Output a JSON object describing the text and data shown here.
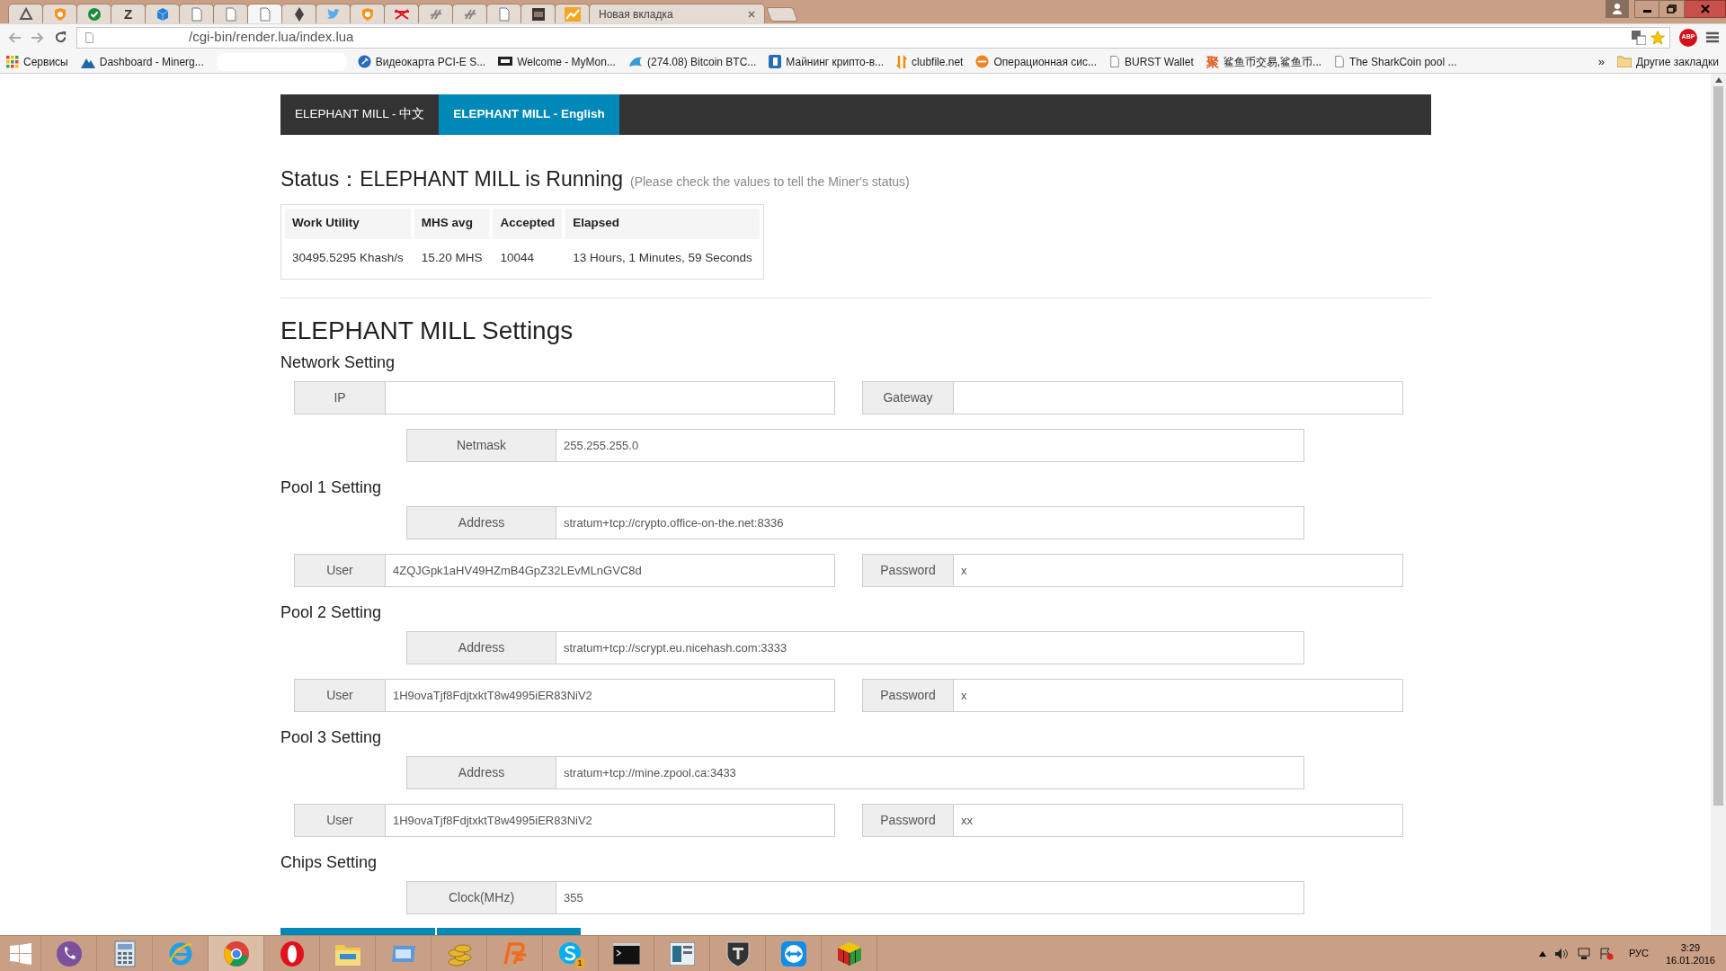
{
  "browser": {
    "tabs": [
      {
        "kind": "triangle",
        "selected": false
      },
      {
        "kind": "coin",
        "selected": false
      },
      {
        "kind": "check",
        "selected": false
      },
      {
        "kind": "letter",
        "glyph": "Z",
        "selected": false
      },
      {
        "kind": "cube",
        "selected": false
      },
      {
        "kind": "doc",
        "selected": false
      },
      {
        "kind": "doc",
        "selected": false
      },
      {
        "kind": "doc",
        "selected": true
      },
      {
        "kind": "diamond",
        "selected": false
      },
      {
        "kind": "bird",
        "selected": false
      },
      {
        "kind": "coin",
        "selected": false
      },
      {
        "kind": "cross",
        "selected": false
      },
      {
        "kind": "chain",
        "selected": false
      },
      {
        "kind": "chain",
        "selected": false
      },
      {
        "kind": "doc",
        "selected": false
      },
      {
        "kind": "box",
        "selected": false
      },
      {
        "kind": "chart",
        "selected": false
      },
      {
        "kind": "text",
        "label": "Новая вкладка",
        "selected": false
      }
    ],
    "url": "/cgi-bin/render.lua/index.lua",
    "adblock": "ABP",
    "bookmarks": [
      {
        "kind": "apps",
        "label": "Сервисы"
      },
      {
        "kind": "mountain",
        "label": "Dashboard - Minerg..."
      },
      {
        "kind": "redacted"
      },
      {
        "kind": "globe",
        "label": "Видеокарта PCI-E S..."
      },
      {
        "kind": "screen",
        "label": "Welcome - MyMon..."
      },
      {
        "kind": "fish",
        "label": "(274.08) Bitcoin BTC..."
      },
      {
        "kind": "coin",
        "label": "Майнинг крипто-в..."
      },
      {
        "kind": "arrows",
        "label": "clubfile.net"
      },
      {
        "kind": "dns",
        "label": "Операционная сис..."
      },
      {
        "kind": "doc",
        "label": "BURST Wallet"
      },
      {
        "kind": "ideogram",
        "glyph": "聚",
        "label": "鲨鱼币交易,鲨鱼币..."
      },
      {
        "kind": "doc",
        "label": "The SharkCoin pool ..."
      }
    ],
    "more": "»",
    "other_bookmarks": "Другие закладки"
  },
  "page": {
    "nav": [
      {
        "label": "ELEPHANT MILL - 中文",
        "selected": false
      },
      {
        "label": "ELEPHANT MILL - English",
        "selected": true
      }
    ],
    "status": {
      "label": "Status：",
      "title": "ELEPHANT MILL is Running",
      "note": "(Please check the values to tell the Miner's status)"
    },
    "status_table": {
      "columns": [
        "Work Utility",
        "MHS avg",
        "Accepted",
        "Elapsed"
      ],
      "rows": [
        [
          "30495.5295 Khash/s",
          "15.20 MHS",
          "10044",
          "13 Hours, 1 Minutes, 59 Seconds"
        ]
      ]
    },
    "settings_title": "ELEPHANT MILL Settings",
    "sections": [
      {
        "title": "Network Setting",
        "rows": [
          [
            {
              "label": "IP"
            },
            {
              "label": "Gateway"
            }
          ],
          [
            {
              "label": "Netmask",
              "value": "255.255.255.0"
            }
          ]
        ]
      },
      {
        "title": "Pool 1 Setting",
        "rows": [
          [
            {
              "label": "Address",
              "value": "stratum+tcp://crypto.office-on-the.net:8336"
            }
          ],
          [
            {
              "label": "User",
              "value": "4ZQJGpk1aHV49HZmB4GpZ32LEvMLnGVC8d"
            },
            {
              "label": "Password",
              "value": "x"
            }
          ]
        ]
      },
      {
        "title": "Pool 2 Setting",
        "rows": [
          [
            {
              "label": "Address",
              "value": "stratum+tcp://scrypt.eu.nicehash.com:3333"
            }
          ],
          [
            {
              "label": "User",
              "value": "1H9ovaTjf8FdjtxktT8w4995iER83NiV2"
            },
            {
              "label": "Password",
              "value": "x"
            }
          ]
        ]
      },
      {
        "title": "Pool 3 Setting",
        "rows": [
          [
            {
              "label": "Address",
              "value": "stratum+tcp://mine.zpool.ca:3433"
            }
          ],
          [
            {
              "label": "User",
              "value": "1H9ovaTjf8FdjtxktT8w4995iER83NiV2"
            },
            {
              "label": "Password",
              "value": "xx"
            }
          ]
        ]
      },
      {
        "title": "Chips Setting",
        "rows": [
          [
            {
              "label": "Clock(MHz)",
              "value": "355"
            }
          ]
        ]
      }
    ],
    "buttons": [
      {
        "kind": "primary"
      },
      {
        "kind": "primary"
      }
    ]
  },
  "taskbar": {
    "apps": [
      {
        "kind": "start",
        "selected": false
      },
      {
        "kind": "viber",
        "selected": false
      },
      {
        "kind": "calculator",
        "selected": false
      },
      {
        "kind": "ie",
        "selected": false
      },
      {
        "kind": "chrome",
        "selected": true
      },
      {
        "kind": "opera",
        "selected": false
      },
      {
        "kind": "folder",
        "selected": false
      },
      {
        "kind": "window",
        "selected": false
      },
      {
        "kind": "coins",
        "selected": false
      },
      {
        "kind": "pf",
        "selected": false
      },
      {
        "kind": "skype",
        "selected": false,
        "badge": "1"
      },
      {
        "kind": "console",
        "selected": false
      },
      {
        "kind": "panel",
        "selected": false
      },
      {
        "kind": "shield",
        "selected": false
      },
      {
        "kind": "teamviewer",
        "selected": false
      },
      {
        "kind": "cube",
        "selected": false
      }
    ],
    "language": "РУС",
    "time": "3:29",
    "date": "16.01.2016"
  }
}
